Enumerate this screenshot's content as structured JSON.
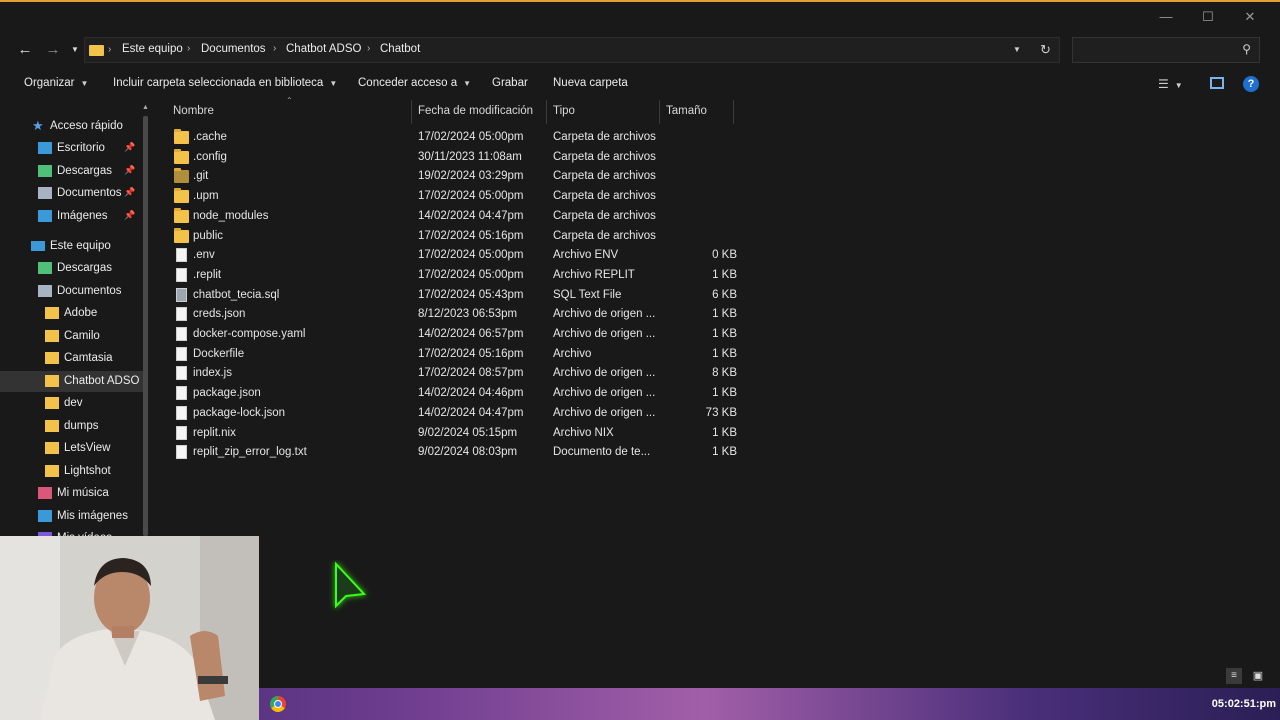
{
  "window": {
    "minimize": "—",
    "maximize": "☐",
    "close": "✕"
  },
  "address": {
    "crumbs": [
      "Este equipo",
      "Documentos",
      "Chatbot ADSO",
      "Chatbot"
    ],
    "search_placeholder": ""
  },
  "toolbar": {
    "organize": "Organizar",
    "include": "Incluir carpeta seleccionada en biblioteca",
    "share": "Conceder acceso a",
    "burn": "Grabar",
    "new_folder": "Nueva carpeta"
  },
  "sidebar": {
    "quick_access": "Acceso rápido",
    "quick_items": [
      {
        "label": "Escritorio",
        "icon": "desktop-icon"
      },
      {
        "label": "Descargas",
        "icon": "download-icon"
      },
      {
        "label": "Documentos",
        "icon": "documents-icon"
      },
      {
        "label": "Imágenes",
        "icon": "pictures-icon"
      }
    ],
    "this_pc": "Este equipo",
    "pc_items": [
      {
        "label": "Descargas",
        "icon": "download-icon"
      },
      {
        "label": "Documentos",
        "icon": "documents-icon"
      },
      {
        "label": "Adobe",
        "icon": "folder-icon"
      },
      {
        "label": "Camilo",
        "icon": "folder-icon"
      },
      {
        "label": "Camtasia",
        "icon": "folder-icon"
      },
      {
        "label": "Chatbot ADSO",
        "icon": "folder-icon"
      },
      {
        "label": "dev",
        "icon": "folder-icon"
      },
      {
        "label": "dumps",
        "icon": "folder-icon"
      },
      {
        "label": "LetsView",
        "icon": "folder-icon"
      },
      {
        "label": "Lightshot",
        "icon": "folder-icon"
      },
      {
        "label": "Mi música",
        "icon": "music-icon"
      },
      {
        "label": "Mis imágenes",
        "icon": "pictures-icon"
      },
      {
        "label": "Mis vídeos",
        "icon": "video-icon"
      }
    ]
  },
  "columns": {
    "name": "Nombre",
    "modified": "Fecha de modificación",
    "type": "Tipo",
    "size": "Tamaño"
  },
  "files": [
    {
      "name": ".cache",
      "date": "17/02/2024 05:00pm",
      "type": "Carpeta de archivos",
      "size": "",
      "kind": "folder"
    },
    {
      "name": ".config",
      "date": "30/11/2023 11:08am",
      "type": "Carpeta de archivos",
      "size": "",
      "kind": "folder"
    },
    {
      "name": ".git",
      "date": "19/02/2024 03:29pm",
      "type": "Carpeta de archivos",
      "size": "",
      "kind": "folder-dim"
    },
    {
      "name": ".upm",
      "date": "17/02/2024 05:00pm",
      "type": "Carpeta de archivos",
      "size": "",
      "kind": "folder"
    },
    {
      "name": "node_modules",
      "date": "14/02/2024 04:47pm",
      "type": "Carpeta de archivos",
      "size": "",
      "kind": "folder"
    },
    {
      "name": "public",
      "date": "17/02/2024 05:16pm",
      "type": "Carpeta de archivos",
      "size": "",
      "kind": "folder"
    },
    {
      "name": ".env",
      "date": "17/02/2024 05:00pm",
      "type": "Archivo ENV",
      "size": "0 KB",
      "kind": "file"
    },
    {
      "name": ".replit",
      "date": "17/02/2024 05:00pm",
      "type": "Archivo REPLIT",
      "size": "1 KB",
      "kind": "file"
    },
    {
      "name": "chatbot_tecia.sql",
      "date": "17/02/2024 05:43pm",
      "type": "SQL Text File",
      "size": "6 KB",
      "kind": "sql"
    },
    {
      "name": "creds.json",
      "date": "8/12/2023 06:53pm",
      "type": "Archivo de origen ...",
      "size": "1 KB",
      "kind": "file"
    },
    {
      "name": "docker-compose.yaml",
      "date": "14/02/2024 06:57pm",
      "type": "Archivo de origen ...",
      "size": "1 KB",
      "kind": "file"
    },
    {
      "name": "Dockerfile",
      "date": "17/02/2024 05:16pm",
      "type": "Archivo",
      "size": "1 KB",
      "kind": "file"
    },
    {
      "name": "index.js",
      "date": "17/02/2024 08:57pm",
      "type": "Archivo de origen ...",
      "size": "8 KB",
      "kind": "file"
    },
    {
      "name": "package.json",
      "date": "14/02/2024 04:46pm",
      "type": "Archivo de origen ...",
      "size": "1 KB",
      "kind": "file"
    },
    {
      "name": "package-lock.json",
      "date": "14/02/2024 04:47pm",
      "type": "Archivo de origen ...",
      "size": "73 KB",
      "kind": "file"
    },
    {
      "name": "replit.nix",
      "date": "9/02/2024 05:15pm",
      "type": "Archivo NIX",
      "size": "1 KB",
      "kind": "file"
    },
    {
      "name": "replit_zip_error_log.txt",
      "date": "9/02/2024 08:03pm",
      "type": "Documento de te...",
      "size": "1 KB",
      "kind": "file"
    }
  ],
  "taskbar": {
    "clock": "05:02:51:pm"
  },
  "colors": {
    "accent_border": "#e0a034",
    "folder": "#f2c24a",
    "window_bg": "#191919",
    "selected": "#333333"
  }
}
